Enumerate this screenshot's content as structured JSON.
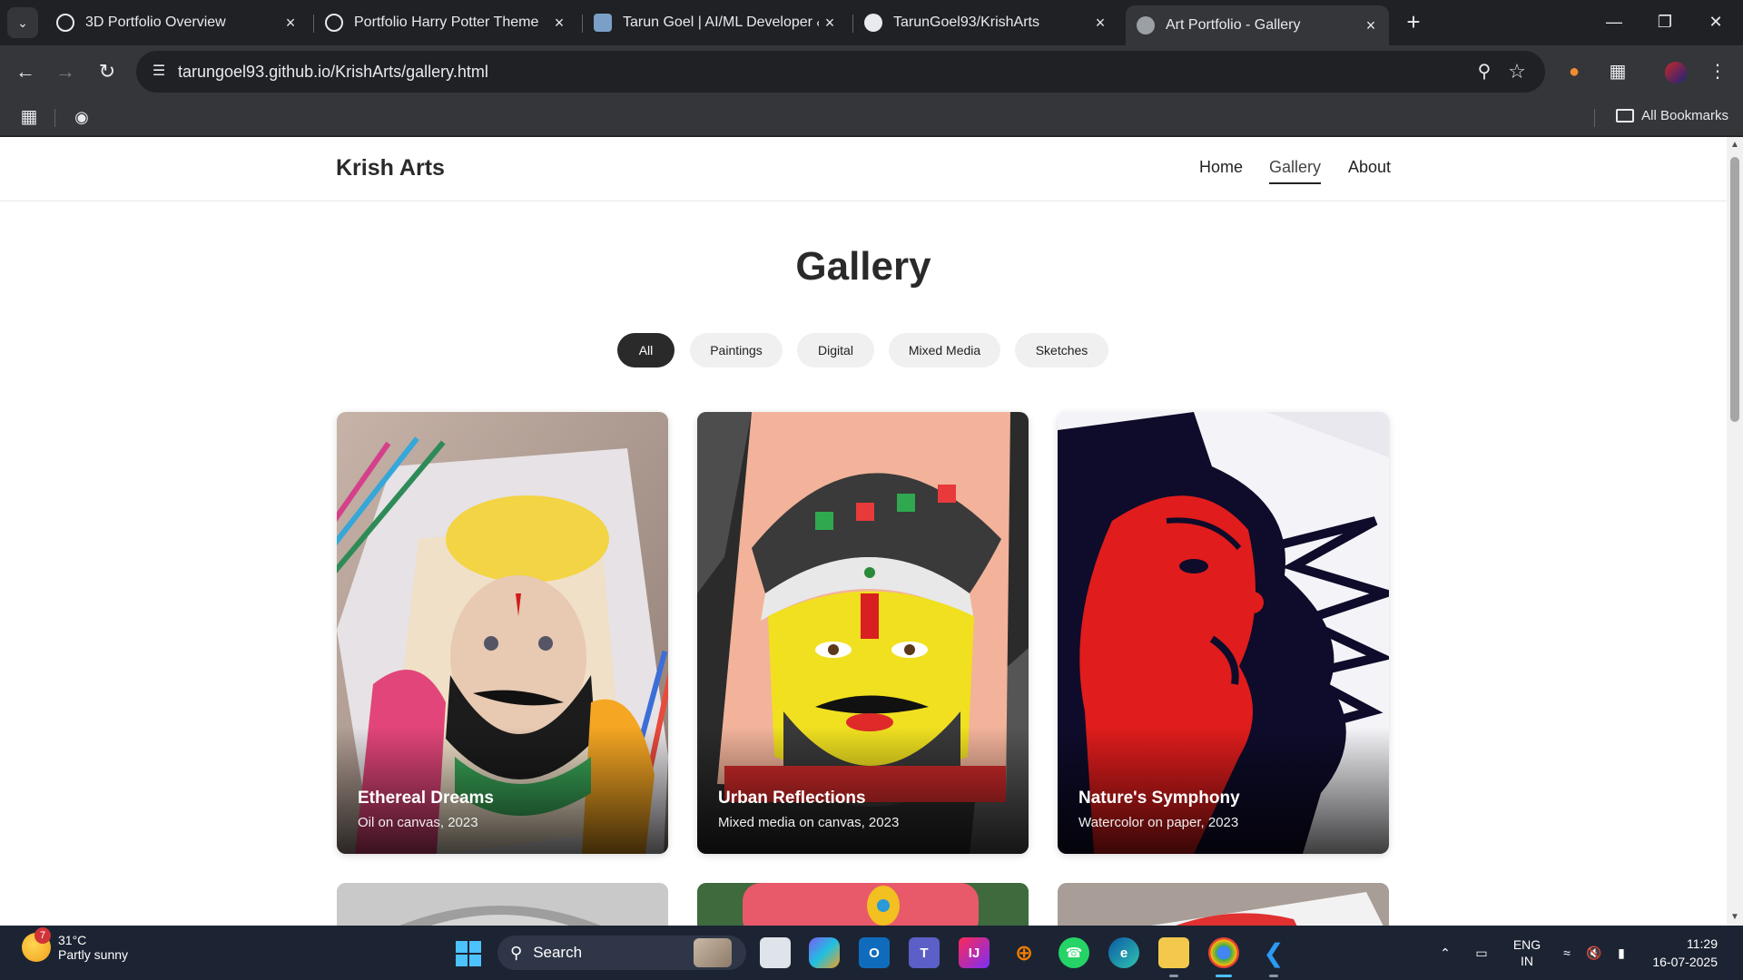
{
  "browser": {
    "tabs": [
      {
        "title": "3D Portfolio Overview",
        "icon": "openai-icon"
      },
      {
        "title": "Portfolio Harry Potter Theme",
        "icon": "openai-icon"
      },
      {
        "title": "Tarun Goel | AI/ML Developer &",
        "icon": "avatar-icon"
      },
      {
        "title": "TarunGoel93/KrishArts",
        "icon": "github-icon"
      },
      {
        "title": "Art Portfolio - Gallery",
        "icon": "globe-icon"
      }
    ],
    "url": "tarungoel93.github.io/KrishArts/gallery.html",
    "bookmarks_label": "All Bookmarks"
  },
  "site": {
    "logo": "Krish Arts",
    "nav": [
      "Home",
      "Gallery",
      "About"
    ],
    "active_nav": "Gallery",
    "heading": "Gallery",
    "filters": [
      "All",
      "Paintings",
      "Digital",
      "Mixed Media",
      "Sketches"
    ],
    "active_filter": "All",
    "artworks": [
      {
        "title": "Ethereal Dreams",
        "subtitle": "Oil on canvas, 2023"
      },
      {
        "title": "Urban Reflections",
        "subtitle": "Mixed media on canvas, 2023"
      },
      {
        "title": "Nature's Symphony",
        "subtitle": "Watercolor on paper, 2023"
      }
    ]
  },
  "taskbar": {
    "weather_badge": "7",
    "temperature": "31°C",
    "condition": "Partly sunny",
    "search_label": "Search",
    "lang_line1": "ENG",
    "lang_line2": "IN",
    "time": "11:29",
    "date": "16-07-2025"
  },
  "colors": {
    "chrome_dark": "#202124",
    "chrome_toolbar": "#35363a",
    "taskbar": "#1c2433",
    "accent": "#4cc2ff"
  }
}
